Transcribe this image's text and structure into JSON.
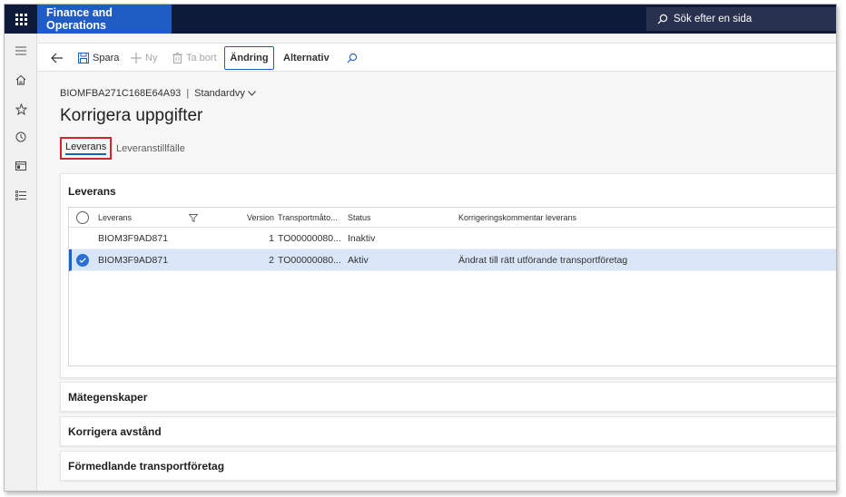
{
  "app": {
    "title": "Finance and Operations",
    "search_placeholder": "Sök efter en sida"
  },
  "rail": {
    "items": [
      "hamburger-icon",
      "home-icon",
      "star-icon",
      "clock-icon",
      "workspace-icon",
      "list-icon"
    ]
  },
  "actionbar": {
    "save": "Spara",
    "new": "Ny",
    "delete": "Ta bort",
    "change": "Ändring",
    "options": "Alternativ"
  },
  "page": {
    "record_id": "BIOMFBA271C168E64A93",
    "view": "Standardvy",
    "title": "Korrigera uppgifter"
  },
  "tabs": [
    {
      "label": "Leverans",
      "active": true
    },
    {
      "label": "Leveranstillfälle",
      "active": false
    }
  ],
  "delivery_panel": {
    "title": "Leverans",
    "columns": {
      "delivery": "Leverans",
      "version": "Version",
      "transport": "Transportmåto...",
      "status": "Status",
      "comment": "Korrigeringskommentar leverans"
    },
    "rows": [
      {
        "delivery": "BIOM3F9AD871",
        "version": "1",
        "transport": "TO00000080...",
        "status": "Inaktiv",
        "comment": "",
        "selected": false
      },
      {
        "delivery": "BIOM3F9AD871",
        "version": "2",
        "transport": "TO00000080...",
        "status": "Aktiv",
        "comment": "Ändrat till rätt utförande transportföretag",
        "selected": true
      }
    ]
  },
  "sections": [
    {
      "title": "Mätegenskaper"
    },
    {
      "title": "Korrigera avstånd"
    },
    {
      "title": "Förmedlande transportföretag"
    }
  ],
  "colors": {
    "topbar": "#0e1a3a",
    "accent": "#1f5cc4",
    "highlight": "#d0252c",
    "selected_row": "#d9e6f8"
  }
}
